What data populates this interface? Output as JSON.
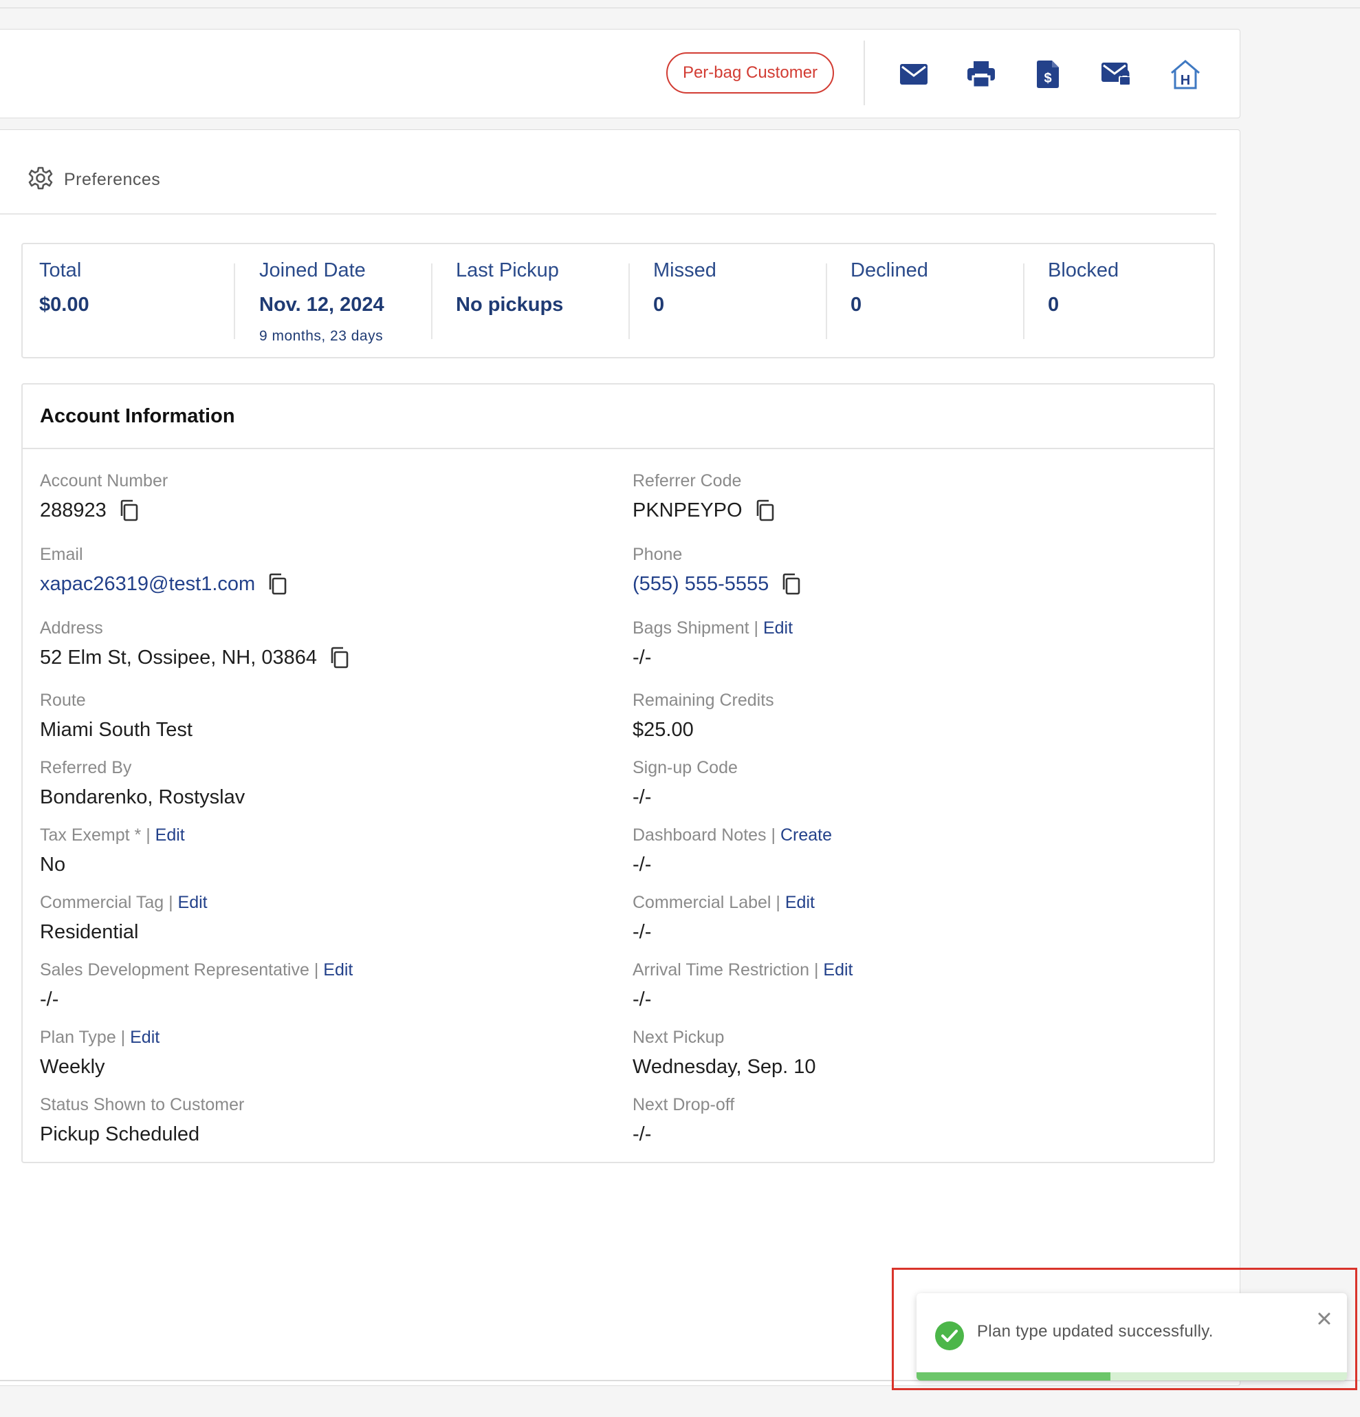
{
  "header": {
    "badge": "Per-bag Customer",
    "icons": [
      "mail-icon",
      "printer-icon",
      "invoice-dollar-icon",
      "secure-mail-icon",
      "home-h-icon"
    ]
  },
  "preferences": {
    "label": "Preferences"
  },
  "stats": [
    {
      "label": "Total",
      "value": "$0.00",
      "sub": ""
    },
    {
      "label": "Joined Date",
      "value": "Nov. 12, 2024",
      "sub": "9 months, 23 days"
    },
    {
      "label": "Last Pickup",
      "value": "No pickups",
      "sub": ""
    },
    {
      "label": "Missed",
      "value": "0",
      "sub": ""
    },
    {
      "label": "Declined",
      "value": "0",
      "sub": ""
    },
    {
      "label": "Blocked",
      "value": "0",
      "sub": ""
    }
  ],
  "account": {
    "title": "Account Information",
    "left": [
      {
        "label": "Account Number",
        "value": "288923",
        "copy": true
      },
      {
        "label": "Email",
        "value": "xapac26319@test1.com",
        "copy": true,
        "link": true
      },
      {
        "label": "Address",
        "value": "52 Elm St, Ossipee, NH, 03864",
        "copy": true
      },
      {
        "label": "Route",
        "value": "Miami South Test"
      },
      {
        "label": "Referred By",
        "value": "Bondarenko, Rostyslav"
      },
      {
        "label": "Tax Exempt *",
        "action": "Edit",
        "value": "No"
      },
      {
        "label": "Commercial Tag",
        "action": "Edit",
        "value": "Residential"
      },
      {
        "label": "Sales Development Representative",
        "action": "Edit",
        "value": "-/-"
      },
      {
        "label": "Plan Type",
        "action": "Edit",
        "value": "Weekly"
      },
      {
        "label": "Status Shown to Customer",
        "value": "Pickup Scheduled"
      }
    ],
    "right": [
      {
        "label": "Referrer Code",
        "value": "PKNPEYPO",
        "copy": true
      },
      {
        "label": "Phone",
        "value": "(555) 555-5555",
        "copy": true,
        "link": true
      },
      {
        "label": "Bags Shipment",
        "action": "Edit",
        "value": "-/-"
      },
      {
        "label": "Remaining Credits",
        "value": "$25.00"
      },
      {
        "label": "Sign-up Code",
        "value": "-/-"
      },
      {
        "label": "Dashboard Notes",
        "action": "Create",
        "value": "-/-"
      },
      {
        "label": "Commercial Label",
        "action": "Edit",
        "value": "-/-"
      },
      {
        "label": "Arrival Time Restriction",
        "action": "Edit",
        "value": "-/-"
      },
      {
        "label": "Next Pickup",
        "value": "Wednesday, Sep. 10"
      },
      {
        "label": "Next Drop-off",
        "value": "-/-"
      }
    ]
  },
  "toast": {
    "message": "Plan type updated successfully.",
    "progress_fraction": 0.45
  },
  "colors": {
    "brand_navy": "#23418a",
    "badge_red": "#d23c33",
    "success_green": "#4cb649"
  }
}
